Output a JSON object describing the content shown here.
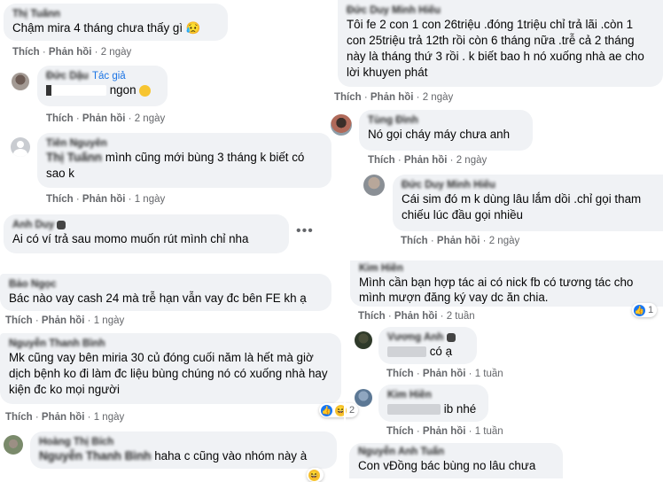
{
  "actions": {
    "like": "Thích",
    "reply": "Phản hồi",
    "sep": " · "
  },
  "comments": [
    {
      "author": "Thị Tuấnn",
      "text": "Chậm mira 4 tháng chưa thấy gì 😥",
      "time": "2 ngày"
    },
    {
      "author": "Đức Dậu",
      "author_tag": "Tác giả",
      "text_visible": "ngon",
      "time": "2 ngày"
    },
    {
      "author": "Tiên Nguyên",
      "mention": "Thị Tuấnn",
      "text": "mình cũng mới bùng 3 tháng k biết có sao k",
      "time": "1 ngày"
    },
    {
      "author": "Anh Duy",
      "text": "Ai có ví trả sau momo muốn rút mình chỉ nha"
    },
    {
      "author": "Bảo Ngọc",
      "text": "Bác nào vay cash 24 mà trễ hạn vẫn vay đc bên FE kh ạ",
      "time": "1 ngày"
    },
    {
      "author": "Nguyễn Thanh Bình",
      "text": "Mk cũng vay bên miria 30 củ đóng cuối năm là hết mà giờ dịch bệnh ko đi làm đc liệu bùng chúng nó có xuống nhà hay kiện đc ko mọi người",
      "time": "1 ngày",
      "reaction_count": "2"
    },
    {
      "author": "Hoàng Thị Bích",
      "mention": "Nguyễn Thanh Bình",
      "text": "haha c cũng vào nhóm này à"
    },
    {
      "author": "Đức Duy Minh Hiếu",
      "text": "Tôi fe 2 con 1 con 26triệu .đóng 1triệu chỉ trả lãi .còn 1 con 25triệu trả 12th rồi còn 6 tháng nữa .trễ cả 2 tháng này là tháng thứ 3 rồi . k biết bao h nó xuống nhà ae cho lời khuyen phát",
      "time": "2 ngày"
    },
    {
      "author": "Tùng Đình",
      "text": "Nó gọi cháy máy chưa anh",
      "time": "2 ngày"
    },
    {
      "author": "Đức Duy Minh Hiếu",
      "text": "Cái sim đó m k dùng lâu lắm dồi .chỉ gọi tham chiếu lúc đầu gọi nhiều",
      "time": "2 ngày"
    },
    {
      "author": "Kim Hiền",
      "text": "Mình cần bạn hợp tác ai có nick fb có tương tác cho mình mượn đăng ký vay dc ăn chia.",
      "time": "2 tuần",
      "reaction_count": "1"
    },
    {
      "author": "Vương Anh",
      "text_visible": "có ạ",
      "time": "1 tuần"
    },
    {
      "author": "Kim Hiền",
      "text_visible": "ib nhé",
      "time": "1 tuần"
    },
    {
      "author": "Nguyễn Anh Tuấn",
      "text": "Con vĐồng bác bùng no lâu chưa"
    }
  ]
}
